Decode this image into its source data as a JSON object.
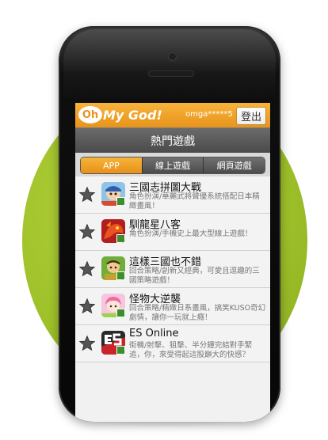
{
  "header": {
    "logo_oh": "Oh",
    "logo_text": "My God!",
    "user": "omga*****5",
    "logout_label": "登出"
  },
  "title": "熱門遊戲",
  "tabs": [
    {
      "label": "APP",
      "active": true
    },
    {
      "label": "線上遊戲",
      "active": false
    },
    {
      "label": "網頁遊戲",
      "active": false
    }
  ],
  "games": [
    {
      "name": "三國志拼圖大戰",
      "desc": "角色扮演/華麗武將聲優系統搭配日本精緻畫風！",
      "icon": "game-icon-pirate"
    },
    {
      "name": "馴龍星八客",
      "desc": "角色扮演/手機史上最大型線上遊戲！",
      "icon": "game-icon-dragon"
    },
    {
      "name": "這樣三國也不錯",
      "desc": "回合策略/創新又經典，可愛且逗趣的三國策略遊戲！",
      "icon": "game-icon-warrior"
    },
    {
      "name": "怪物大逆襲",
      "desc": "回合策略/精緻日系畫風，搞笑KUSO奇幻劇情，讓你一玩就上癮！",
      "icon": "game-icon-girl"
    },
    {
      "name": "ES Online",
      "desc": "街機/射擊、狙擊、半分鐘完結對手緊追，你，來受得起這股巔大的快感？",
      "icon": "game-icon-es"
    }
  ],
  "colors": {
    "accent": "#e8931c",
    "green": "#9fc12a"
  }
}
